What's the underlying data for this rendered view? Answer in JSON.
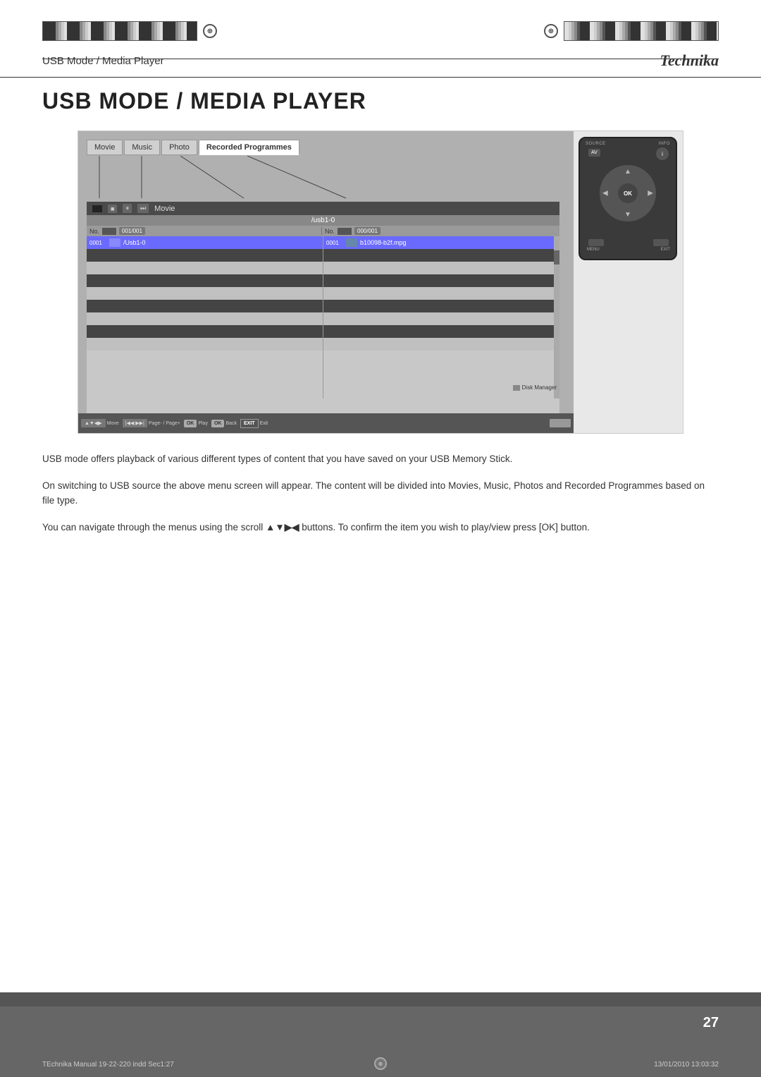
{
  "header": {
    "subtitle": "USB Mode / Media Player",
    "brand": "Technika"
  },
  "page": {
    "title": "USB MODE / MEDIA PLAYER",
    "number": "27"
  },
  "remote": {
    "source_label": "SOURCE",
    "info_label": "INFO",
    "av_label": "AV",
    "ok_label": "OK",
    "menu_label": "MENU",
    "exit_label": "EXIT"
  },
  "tabs": [
    {
      "label": "Movie",
      "active": false
    },
    {
      "label": "Music",
      "active": false
    },
    {
      "label": "Photo",
      "active": false
    },
    {
      "label": "Recorded Programmes",
      "active": true
    }
  ],
  "screen": {
    "movie_title": "Movie",
    "path": "/usb1-0",
    "left_counter": "001/001",
    "right_counter": "000/001",
    "left_no_label": "No.",
    "right_no_label": "No.",
    "left_row_num": "0001",
    "left_row_name": "/Usb1-0",
    "right_row_num": "0001",
    "right_row_name": "b10098-b2f.mpg",
    "disk_manager_label": "Disk Manager"
  },
  "statusbar": {
    "btn1": "▲▼◀▶ Move",
    "btn2": "|◀◀ ▶▶| Page- / Page+",
    "btn3": "OK Play",
    "btn4": "OK Back",
    "btn5": "EXIT",
    "btn6": "Exit"
  },
  "body": {
    "para1": "USB mode offers playback of various different types of content that you have saved on your USB Memory Stick.",
    "para2": "On switching to USB source the above menu screen will appear. The content will be divided into Movies, Music, Photos and Recorded Programmes based on file type.",
    "para3_prefix": "You can navigate through the menus using the scroll ",
    "para3_arrows": "▲▼▶◀",
    "para3_suffix": " buttons. To confirm the item you wish to play/view press [OK] button."
  },
  "footer": {
    "left_text": "TEchnika Manual 19-22-220  indd  Sec1:27",
    "right_text": "13/01/2010  13:03:32"
  }
}
